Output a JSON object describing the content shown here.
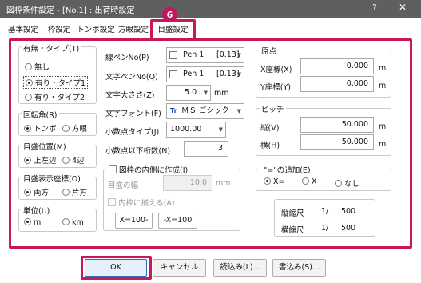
{
  "window": {
    "title": "図枠条件設定 - [No.1] : 出荷時設定",
    "help": "?",
    "close": "✕"
  },
  "badge": "6",
  "tabs": [
    {
      "label": "基本設定"
    },
    {
      "label": "枠設定"
    },
    {
      "label": "トンボ設定"
    },
    {
      "label": "方眼設定"
    },
    {
      "label": "目盛設定"
    }
  ],
  "presence": {
    "title": "有無・タイプ(T)",
    "options": [
      "無し",
      "有り・タイプ1",
      "有り・タイプ2"
    ]
  },
  "rotation": {
    "title": "回転角(R)",
    "options": [
      "トンボ",
      "方眼"
    ]
  },
  "position": {
    "title": "目盛位置(M)",
    "options": [
      "上左辺",
      "4辺"
    ]
  },
  "coords": {
    "title": "目盛表示座標(O)",
    "options": [
      "両方",
      "片方"
    ]
  },
  "unit": {
    "title": "単位(U)",
    "options": [
      "m",
      "km"
    ]
  },
  "line_pen": {
    "label": "線ペンNo(P)",
    "value": "Pen 1",
    "width": "[0.13]"
  },
  "text_pen": {
    "label": "文字ペンNo(Q)",
    "value": "Pen 1",
    "width": "[0.13]"
  },
  "text_size": {
    "label": "文字大きさ(Z)",
    "value": "5.0",
    "unit": "mm"
  },
  "text_font": {
    "label": "文字フォント(F)",
    "font_icon": "Tr",
    "value": "ＭＳ ゴシック"
  },
  "decimal_type": {
    "label": "小数点タイプ(J)",
    "value": "1000.00"
  },
  "decimal_digits": {
    "label": "小数点以下桁数(N)",
    "value": "3"
  },
  "inner_frame": {
    "label": "図枠の内側に作成(I)",
    "width_label": "目盛の幅",
    "width_value": "10.0",
    "width_unit": "mm",
    "align_label": "内枠に揃える(A)",
    "btn_x100": "X=100-",
    "btn_neg_x100": "-X=100"
  },
  "origin": {
    "title": "原点",
    "x_label": "X座標(X)",
    "x_value": "0.000",
    "y_label": "Y座標(Y)",
    "y_value": "0.000",
    "unit": "m"
  },
  "pitch": {
    "title": "ピッチ",
    "v_label": "縦(V)",
    "v_value": "50.000",
    "h_label": "横(H)",
    "h_value": "50.000",
    "unit": "m"
  },
  "equals": {
    "title": "\"=\"の追加(E)",
    "options": [
      "X=",
      "X",
      "なし"
    ]
  },
  "scale": {
    "vertical_label": "縦縮尺",
    "vertical_sep": "1/",
    "vertical_value": "500",
    "horizontal_label": "横縮尺",
    "horizontal_sep": "1/",
    "horizontal_value": "500"
  },
  "buttons": {
    "ok": "OK",
    "cancel": "キャンセル",
    "load": "読込み(L)...",
    "save": "書込み(S)..."
  },
  "colors": {
    "highlight": "#c8185a",
    "titlebar": "#5f5f5f"
  }
}
